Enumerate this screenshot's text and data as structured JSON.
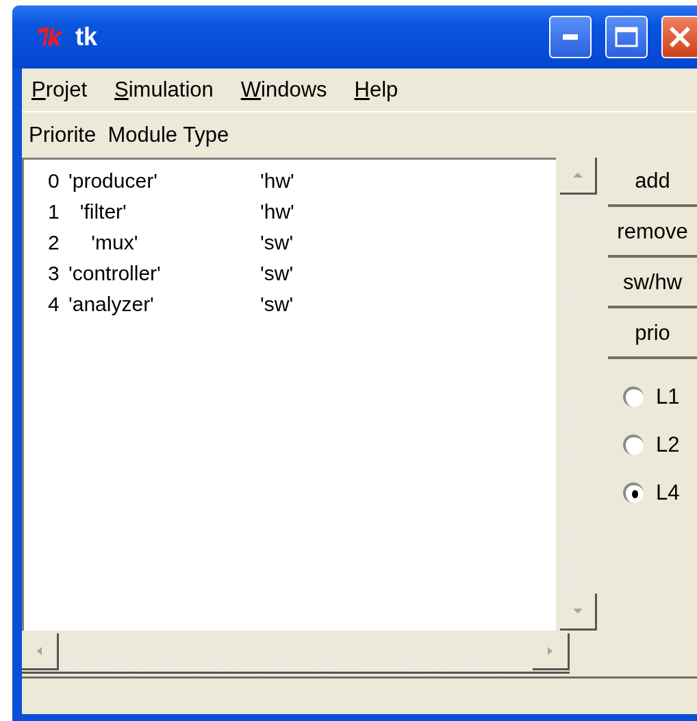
{
  "window": {
    "title": "tk"
  },
  "menu": [
    {
      "label": "Projet"
    },
    {
      "label": "Simulation"
    },
    {
      "label": "Windows"
    },
    {
      "label": "Help"
    }
  ],
  "header": "Priorite  Module Type",
  "rows": [
    {
      "index": "0",
      "module": "'producer'",
      "type": "'hw'"
    },
    {
      "index": "1",
      "module": "  'filter'",
      "type": "'hw'"
    },
    {
      "index": "2",
      "module": "    'mux'",
      "type": "'sw'"
    },
    {
      "index": "3",
      "module": "'controller'",
      "type": "'sw'"
    },
    {
      "index": "4",
      "module": "'analyzer'",
      "type": "'sw'"
    }
  ],
  "buttons": [
    "add",
    "remove",
    "sw/hw",
    "prio"
  ],
  "levels": [
    {
      "label": "L1",
      "selected": false
    },
    {
      "label": "L2",
      "selected": false
    },
    {
      "label": "L4",
      "selected": true
    }
  ]
}
